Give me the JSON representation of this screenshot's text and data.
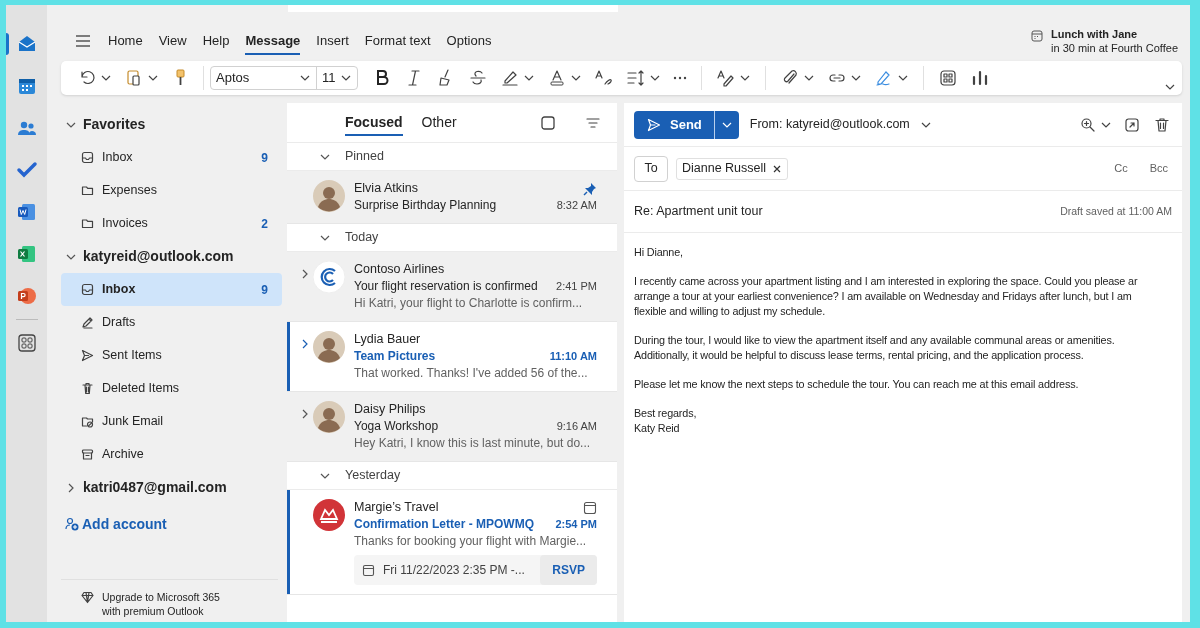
{
  "rail": [
    {
      "kind": "mail",
      "selected": true
    },
    {
      "kind": "calendar",
      "selected": false
    },
    {
      "kind": "people",
      "selected": false
    },
    {
      "kind": "todo",
      "selected": false
    },
    {
      "kind": "word",
      "selected": false
    },
    {
      "kind": "excel",
      "selected": false
    },
    {
      "kind": "powerpoint",
      "selected": false
    },
    {
      "kind": "apps",
      "selected": false
    }
  ],
  "ribbon": {
    "tabs": [
      {
        "label": "Home",
        "selected": false
      },
      {
        "label": "View",
        "selected": false
      },
      {
        "label": "Help",
        "selected": false
      },
      {
        "label": "Message",
        "selected": true
      },
      {
        "label": "Insert",
        "selected": false
      },
      {
        "label": "Format text",
        "selected": false
      },
      {
        "label": "Options",
        "selected": false
      }
    ],
    "reminder": {
      "title": "Lunch with Jane",
      "detail": "in 30 min at Fourth Coffee"
    },
    "font": "Aptos",
    "font_size": "11",
    "tools": [
      {
        "kind": "undo",
        "dropdown": true
      },
      {
        "kind": "paste",
        "dropdown": true
      },
      {
        "kind": "painter",
        "dropdown": false
      },
      {
        "kind": "fonts"
      },
      {
        "kind": "bold",
        "dropdown": false
      },
      {
        "kind": "italic",
        "dropdown": false
      },
      {
        "kind": "clear",
        "dropdown": false
      },
      {
        "kind": "strike",
        "dropdown": false
      },
      {
        "kind": "highlight",
        "dropdown": true
      },
      {
        "kind": "color",
        "dropdown": true
      },
      {
        "kind": "styles",
        "dropdown": false
      },
      {
        "kind": "spacing",
        "dropdown": true
      },
      {
        "kind": "more",
        "dropdown": false
      },
      {
        "kind": "sep"
      },
      {
        "kind": "editor",
        "dropdown": true
      },
      {
        "kind": "sep"
      },
      {
        "kind": "attach",
        "dropdown": true
      },
      {
        "kind": "link",
        "dropdown": true
      },
      {
        "kind": "sign",
        "dropdown": true
      },
      {
        "kind": "sep"
      },
      {
        "kind": "apps",
        "dropdown": false
      },
      {
        "kind": "poll",
        "dropdown": false
      }
    ]
  },
  "folders": [
    {
      "label": "Favorites",
      "expanded": true,
      "children": [
        {
          "label": "Inbox",
          "kind": "inbox",
          "count": "9",
          "selected": false
        },
        {
          "label": "Expenses",
          "kind": "folder",
          "selected": false
        },
        {
          "label": "Invoices",
          "kind": "folder",
          "count": "2",
          "selected": false
        }
      ]
    },
    {
      "label": "katyreid@outlook.com",
      "expanded": true,
      "children": [
        {
          "label": "Inbox",
          "kind": "inbox",
          "count": "9",
          "selected": true
        },
        {
          "label": "Drafts",
          "kind": "drafts",
          "selected": false
        },
        {
          "label": "Sent Items",
          "kind": "sent",
          "selected": false
        },
        {
          "label": "Deleted Items",
          "kind": "deleted",
          "selected": false
        },
        {
          "label": "Junk Email",
          "kind": "junk",
          "selected": false
        },
        {
          "label": "Archive",
          "kind": "archive",
          "selected": false
        }
      ]
    },
    {
      "label": "katri0487@gmail.com",
      "expanded": false
    }
  ],
  "add_account": "Add account",
  "upgrade": [
    "Upgrade to Microsoft 365",
    "with premium Outlook"
  ],
  "list": {
    "tabs": [
      {
        "label": "Focused",
        "selected": true
      },
      {
        "label": "Other",
        "selected": false
      }
    ],
    "groups": [
      {
        "label": "Pinned",
        "expanded": true,
        "items": [
          {
            "sender": "Elvia Atkins",
            "subject": "Surprise Birthday Planning",
            "time": "8:32 AM",
            "kind": "person",
            "unread": false,
            "pinned": true,
            "thread": false
          }
        ]
      },
      {
        "label": "Today",
        "expanded": true,
        "items": [
          {
            "sender": "Contoso Airlines",
            "subject": "Your flight reservation is confirmed",
            "time": "2:41 PM",
            "preview": "Hi Katri, your flight to Charlotte is confirm...",
            "kind": "contoso",
            "unread": false,
            "pinned": false,
            "thread": true
          },
          {
            "sender": "Lydia Bauer",
            "subject": "Team Pictures",
            "time": "11:10 AM",
            "preview": "That worked. Thanks! I've added 56 of the...",
            "kind": "person",
            "unread": true,
            "pinned": false,
            "thread": true
          },
          {
            "sender": "Daisy Philips",
            "subject": "Yoga Workshop",
            "time": "9:16 AM",
            "preview": "Hey Katri, I know this is last minute, but do...",
            "kind": "person",
            "unread": false,
            "pinned": false,
            "thread": true
          }
        ]
      },
      {
        "label": "Yesterday",
        "expanded": true,
        "items": [
          {
            "sender": "Margie’s Travel",
            "subject": "Confirmation Letter - MPOWMQ",
            "time": "2:54 PM",
            "preview": "Thanks for booking your flight with Margie...",
            "kind": "travel",
            "unread": true,
            "pinned": false,
            "thread": false,
            "invite": {
              "when": "Fri 11/22/2023 2:35 PM -...",
              "action": "RSVP"
            }
          }
        ]
      }
    ]
  },
  "compose": {
    "send": "Send",
    "from": "From: katyreid@outlook.com",
    "to_label": "To",
    "recipients": [
      "Dianne Russell"
    ],
    "cc": "Cc",
    "bcc": "Bcc",
    "subject": "Re: Apartment unit tour",
    "saved": "Draft saved at 11:00 AM",
    "body": [
      [
        "Hi Dianne,"
      ],
      [
        "I recently came across your apartment listing and I am interested in exploring the space. Could you please ar",
        "arrange a tour at your earliest convenience? I am available on Wednesday and Fridays after lunch, but I am",
        "flexible and willing to adjust my schedule."
      ],
      [
        "During the tour, I would like to view the apartment itself and any available communal areas or amenities.",
        "Additionally, it would be helpful to discuss lease terms, rental pricing, and the application process."
      ],
      [
        "Please let me know the next steps to schedule the tour. You can reach me at this email address."
      ],
      [
        "Best regards,",
        "Katy Reid"
      ]
    ]
  }
}
